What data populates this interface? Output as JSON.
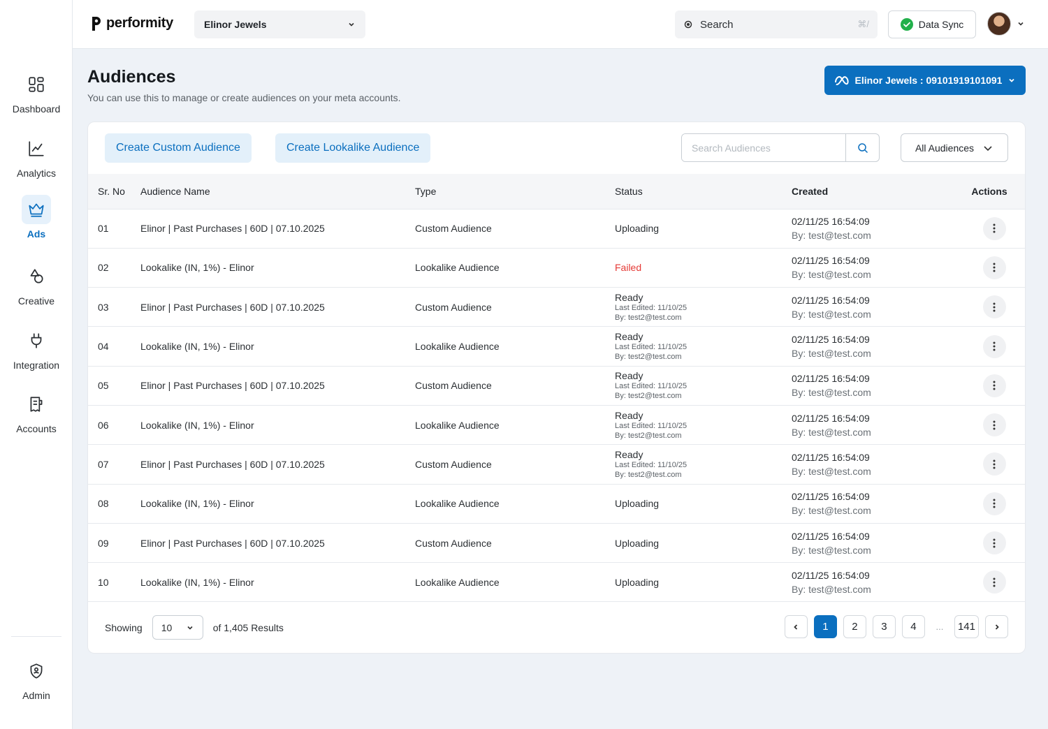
{
  "app": {
    "brand": "performity"
  },
  "topbar": {
    "account_name": "Elinor Jewels",
    "search_label": "Search",
    "search_shortcut": "⌘/",
    "sync_label": "Data Sync"
  },
  "sidebar": {
    "items": [
      {
        "label": "Dashboard",
        "icon": "dashboard-icon",
        "active": false
      },
      {
        "label": "Analytics",
        "icon": "analytics-icon",
        "active": false
      },
      {
        "label": "Ads",
        "icon": "crown-icon",
        "active": true
      },
      {
        "label": "Creative",
        "icon": "creative-icon",
        "active": false
      },
      {
        "label": "Integration",
        "icon": "plug-icon",
        "active": false
      },
      {
        "label": "Accounts",
        "icon": "accounts-icon",
        "active": false
      }
    ],
    "admin_label": "Admin"
  },
  "page": {
    "title": "Audiences",
    "subtitle": "You can use this to manage or create audiences on your meta accounts.",
    "meta_account": "Elinor Jewels : 09101919101091"
  },
  "toolbar": {
    "create_custom": "Create Custom Audience",
    "create_lookalike": "Create Lookalike Audience",
    "search_placeholder": "Search Audiences",
    "filter_label": "All Audiences"
  },
  "table": {
    "headers": [
      "Sr. No",
      "Audience Name",
      "Type",
      "Status",
      "Created",
      "Actions"
    ],
    "rows": [
      {
        "sr": "01",
        "name": "Elinor | Past Purchases | 60D | 07.10.2025",
        "type": "Custom Audience",
        "status": "Uploading",
        "edited": "",
        "edited_by": "",
        "created": "02/11/25 16:54:09",
        "created_by": "By: test@test.com"
      },
      {
        "sr": "02",
        "name": "Lookalike (IN, 1%) - Elinor",
        "type": "Lookalike Audience",
        "status": "Failed",
        "edited": "",
        "edited_by": "",
        "created": "02/11/25 16:54:09",
        "created_by": "By: test@test.com"
      },
      {
        "sr": "03",
        "name": "Elinor | Past Purchases | 60D | 07.10.2025",
        "type": "Custom Audience",
        "status": "Ready",
        "edited": "Last Edited: 11/10/25",
        "edited_by": "By: test2@test.com",
        "created": "02/11/25 16:54:09",
        "created_by": "By: test@test.com"
      },
      {
        "sr": "04",
        "name": "Lookalike (IN, 1%) - Elinor",
        "type": "Lookalike Audience",
        "status": "Ready",
        "edited": "Last Edited: 11/10/25",
        "edited_by": "By: test2@test.com",
        "created": "02/11/25 16:54:09",
        "created_by": "By: test@test.com"
      },
      {
        "sr": "05",
        "name": "Elinor | Past Purchases | 60D | 07.10.2025",
        "type": "Custom Audience",
        "status": "Ready",
        "edited": "Last Edited: 11/10/25",
        "edited_by": "By: test2@test.com",
        "created": "02/11/25 16:54:09",
        "created_by": "By: test@test.com"
      },
      {
        "sr": "06",
        "name": "Lookalike (IN, 1%) - Elinor",
        "type": "Lookalike Audience",
        "status": "Ready",
        "edited": "Last Edited: 11/10/25",
        "edited_by": "By: test2@test.com",
        "created": "02/11/25 16:54:09",
        "created_by": "By: test@test.com"
      },
      {
        "sr": "07",
        "name": "Elinor | Past Purchases | 60D | 07.10.2025",
        "type": "Custom Audience",
        "status": "Ready",
        "edited": "Last Edited: 11/10/25",
        "edited_by": "By: test2@test.com",
        "created": "02/11/25 16:54:09",
        "created_by": "By: test@test.com"
      },
      {
        "sr": "08",
        "name": "Lookalike (IN, 1%) - Elinor",
        "type": "Lookalike Audience",
        "status": "Uploading",
        "edited": "",
        "edited_by": "",
        "created": "02/11/25 16:54:09",
        "created_by": "By: test@test.com"
      },
      {
        "sr": "09",
        "name": "Elinor | Past Purchases | 60D | 07.10.2025",
        "type": "Custom Audience",
        "status": "Uploading",
        "edited": "",
        "edited_by": "",
        "created": "02/11/25 16:54:09",
        "created_by": "By: test@test.com"
      },
      {
        "sr": "10",
        "name": "Lookalike (IN, 1%) - Elinor",
        "type": "Lookalike Audience",
        "status": "Uploading",
        "edited": "",
        "edited_by": "",
        "created": "02/11/25 16:54:09",
        "created_by": "By: test@test.com"
      }
    ]
  },
  "footer": {
    "showing_label": "Showing",
    "page_size": "10",
    "results_label": "of 1,405 Results",
    "pages": [
      "1",
      "2",
      "3",
      "4"
    ],
    "ellipsis": "...",
    "last_page": "141",
    "current_page": "1"
  },
  "colors": {
    "accent": "#0b6fbf",
    "failed": "#e53935",
    "sync_ok": "#22b04b"
  }
}
